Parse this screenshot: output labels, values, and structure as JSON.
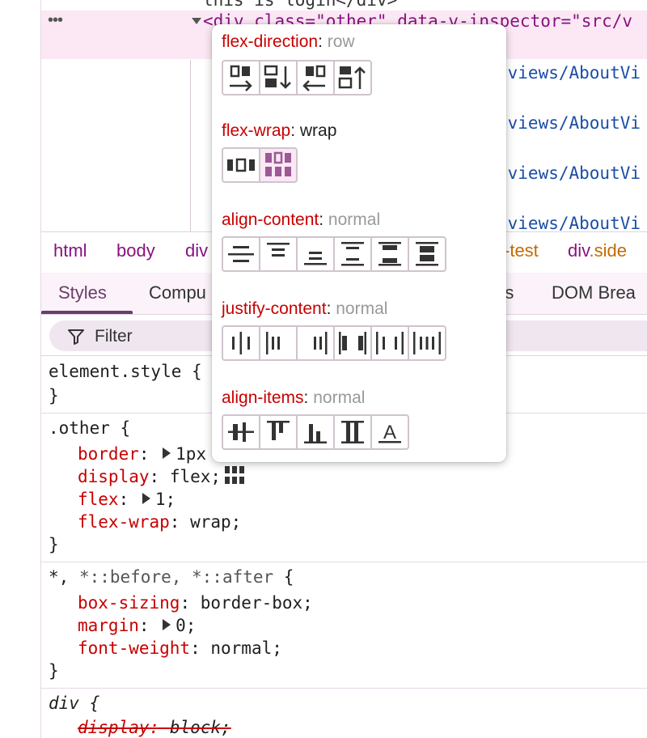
{
  "elements": {
    "top_line": "this is login</div>",
    "ellipsis": "•••",
    "selected_line": "<div class=\"other\" data-v-inspector=\"src/v",
    "child_lines": [
      "/views/AboutVi",
      "/views/AboutVi",
      "/views/AboutVi",
      "/views/AboutVi"
    ]
  },
  "breadcrumbs": {
    "html": "html",
    "body": "body",
    "div": "div",
    "test": "-test",
    "side_tag": "div",
    "side_class": ".side"
  },
  "tabs": {
    "styles": "Styles",
    "computed": "Compu",
    "listeners": "rs",
    "dom_breakpoints": "DOM Brea"
  },
  "filter": {
    "label": "Filter"
  },
  "rules": {
    "element_style": {
      "selector": "element.style {",
      "close": "}"
    },
    "other": {
      "selector": ".other {",
      "border_prop": "border",
      "border_val": "1px",
      "display_prop": "display",
      "display_val": "flex;",
      "flex_prop": "flex",
      "flex_val": "1;",
      "wrap_prop": "flex-wrap",
      "wrap_val": "wrap;",
      "close": "}"
    },
    "universal": {
      "selector_a": "*, ",
      "selector_b": "*::before, *::after",
      "selector_c": " {",
      "box_prop": "box-sizing",
      "box_val": "border-box;",
      "margin_prop": "margin",
      "margin_val": "0;",
      "fw_prop": "font-weight",
      "fw_val": "normal;",
      "close": "}"
    },
    "div": {
      "selector": "div {",
      "display_prop": "display",
      "display_val": "block;"
    }
  },
  "popover": {
    "flex_direction": {
      "key": "flex-direction",
      "value": "row"
    },
    "flex_wrap": {
      "key": "flex-wrap",
      "value": "wrap"
    },
    "align_content": {
      "key": "align-content",
      "value": "normal"
    },
    "justify_content": {
      "key": "justify-content",
      "value": "normal"
    },
    "align_items": {
      "key": "align-items",
      "value": "normal"
    },
    "align_items_text_glyph": "A"
  },
  "colors": {
    "property": "#c80000",
    "tag": "#881280",
    "accent": "#6b3d6b",
    "active_bg": "#fbe8f4",
    "icon_active": "#9b5a96"
  }
}
